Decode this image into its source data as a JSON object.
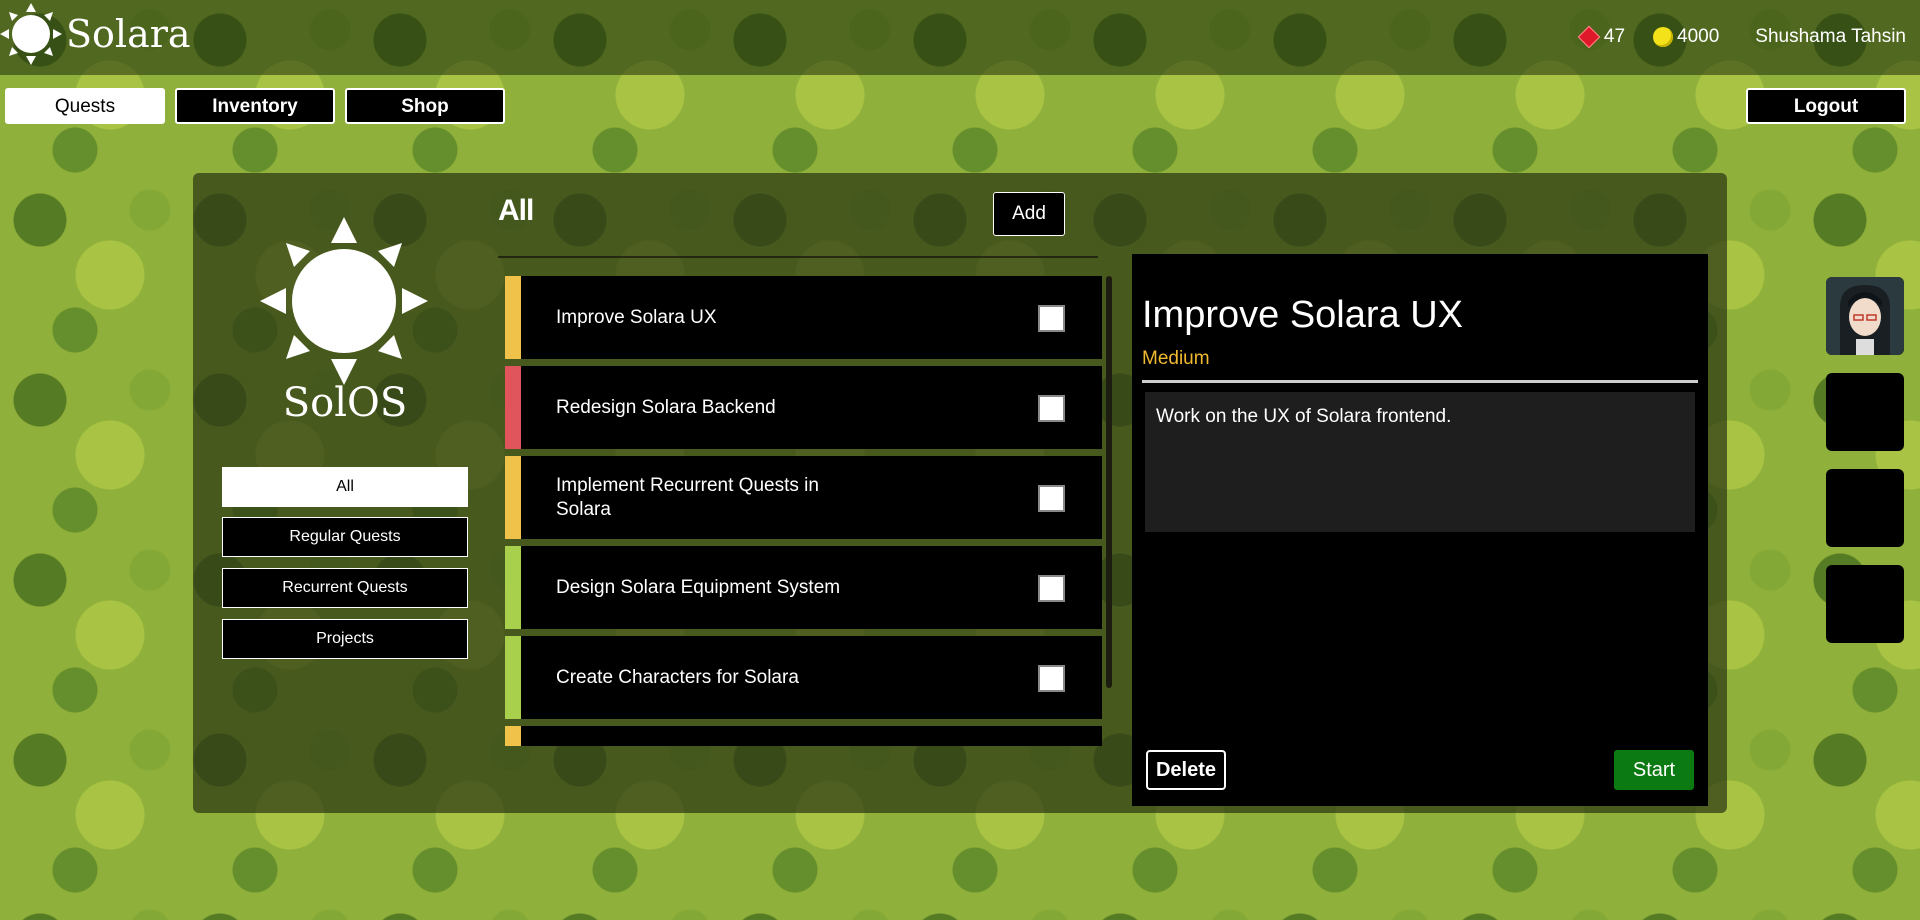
{
  "app": {
    "name": "Solara"
  },
  "header": {
    "gems": "47",
    "coins": "4000",
    "username": "Shushama Tahsin"
  },
  "nav": {
    "quests": "Quests",
    "inventory": "Inventory",
    "shop": "Shop",
    "logout": "Logout"
  },
  "sidebar": {
    "brand": "SolOS",
    "filters": [
      "All",
      "Regular Quests",
      "Recurrent Quests",
      "Projects"
    ],
    "active_filter": "All"
  },
  "quest_list": {
    "title": "All",
    "add_label": "Add",
    "items": [
      {
        "name": "Improve Solara UX",
        "color": "#f0c24a"
      },
      {
        "name": "Redesign Solara Backend",
        "color": "#e0545c"
      },
      {
        "name": "Implement Recurrent Quests in Solara",
        "color": "#f0c24a"
      },
      {
        "name": "Design Solara Equipment System",
        "color": "#a8d04c"
      },
      {
        "name": "Create Characters for Solara",
        "color": "#a8d04c"
      },
      {
        "name": "",
        "color": "#f0c24a"
      }
    ]
  },
  "detail": {
    "title": "Improve Solara UX",
    "difficulty": "Medium",
    "description": "Work on the UX of Solara frontend.",
    "delete_label": "Delete",
    "start_label": "Start"
  },
  "colors": {
    "medium": "#f0b92f",
    "start": "#0c7a12",
    "gem": "#e0192a",
    "coin": "#f3e21a"
  }
}
